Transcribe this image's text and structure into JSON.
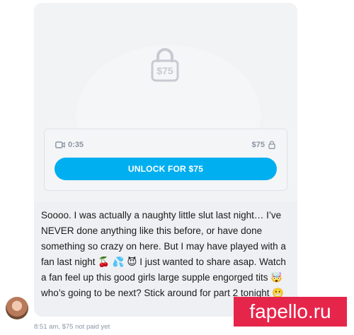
{
  "locked_media": {
    "price_overlay": "$75",
    "duration": "0:35",
    "price": "$75",
    "unlock_label": "UNLOCK FOR $75"
  },
  "message": {
    "text": "Soooo. I was actually a naughty little slut last night… I’ve NEVER done anything like this before, or have done something so crazy on here. But I may have played with a fan last night 🍒 💦 😈 I just wanted to share asap. Watch a fan feel up this good girls large supple engorged tits 🤯 who’s going to be next? Stick around for part 2 tonight 😬",
    "time": "8:51 am,",
    "payment_status": "$75 not paid yet"
  },
  "watermark_text": "fapello.ru",
  "colors": {
    "accent": "#00aff0",
    "brand": "#e6254b",
    "muted": "#8a96a3"
  },
  "icons": [
    "lock-icon",
    "video-camera-icon"
  ]
}
